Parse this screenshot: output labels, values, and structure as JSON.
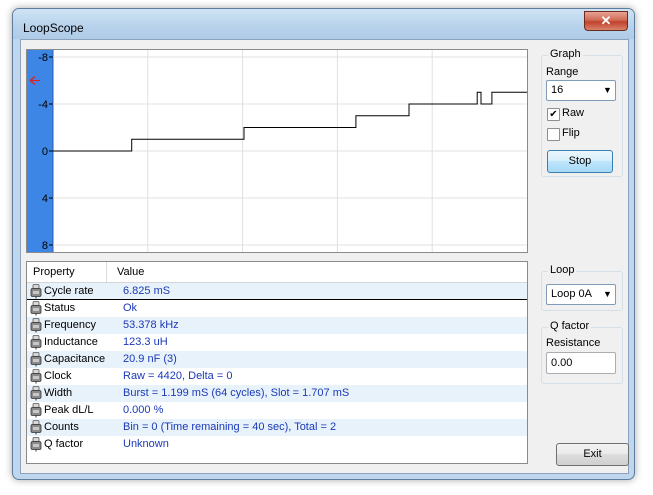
{
  "window": {
    "title": "LoopScope",
    "close_glyph": "✕"
  },
  "chart_data": {
    "type": "line",
    "title": "",
    "xlabel": "",
    "ylabel": "",
    "y_ticks": [
      "-8",
      "-4",
      "0",
      "4",
      "8"
    ],
    "y_tick_values": [
      -8,
      -4,
      0,
      4,
      8
    ],
    "ylim": [
      -8,
      8
    ],
    "y_inverted": true,
    "xlim": [
      0,
      100
    ],
    "grid": true,
    "marker_value": -6,
    "colors": {
      "axis_bar": "#3d86e5",
      "marker": "#e02020",
      "line": "#000000",
      "grid": "#e0e0e0"
    },
    "series": [
      {
        "x": [
          0,
          16.6,
          16.6,
          40.3,
          40.3,
          63.9,
          63.9,
          75.1,
          75.1,
          89.5,
          89.5,
          90.3,
          90.3,
          92.6,
          92.6,
          100
        ],
        "values": [
          0,
          0,
          -1,
          -1,
          -2,
          -2,
          -3,
          -3,
          -4,
          -4,
          -5,
          -5,
          -4,
          -4,
          -5,
          -5
        ]
      }
    ]
  },
  "list": {
    "headers": {
      "property": "Property",
      "value": "Value"
    },
    "rows": [
      {
        "property": "Cycle rate",
        "value": "6.825 mS"
      },
      {
        "property": "Status",
        "value": "Ok"
      },
      {
        "property": "Frequency",
        "value": "53.378 kHz"
      },
      {
        "property": "Inductance",
        "value": "123.3 uH"
      },
      {
        "property": "Capacitance",
        "value": "20.9 nF (3)"
      },
      {
        "property": "Clock",
        "value": "Raw = 4420, Delta = 0"
      },
      {
        "property": "Width",
        "value": "Burst = 1.199 mS (64 cycles), Slot = 1.707 mS"
      },
      {
        "property": "Peak dL/L",
        "value": "0.000 %"
      },
      {
        "property": "Counts",
        "value": "Bin = 0 (Time remaining = 40 sec), Total = 2"
      },
      {
        "property": "Q factor",
        "value": "Unknown"
      }
    ],
    "row_icon": "probe-icon"
  },
  "graph": {
    "group_label": "Graph",
    "range_label": "Range",
    "range_value": "16",
    "raw_label": "Raw",
    "raw_checked": true,
    "flip_label": "Flip",
    "flip_checked": false,
    "stop_label": "Stop"
  },
  "loop": {
    "group_label": "Loop",
    "value": "Loop 0A"
  },
  "qfactor": {
    "group_label": "Q factor",
    "resistance_label": "Resistance",
    "resistance_value": "0.00"
  },
  "exit_label": "Exit",
  "dropdown_glyph": "▼",
  "check_glyph": "✔"
}
